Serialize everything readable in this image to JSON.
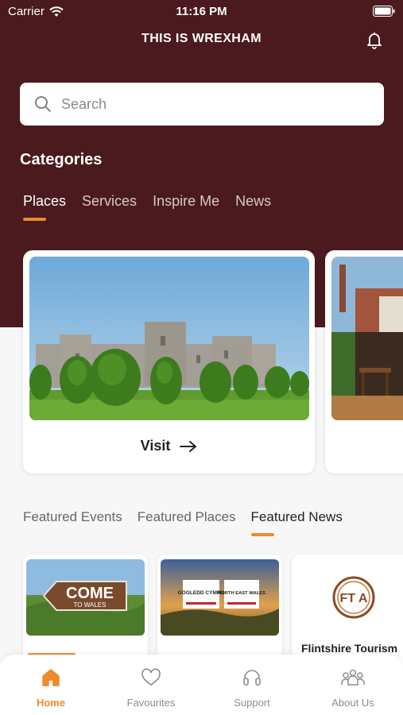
{
  "status_bar": {
    "carrier": "Carrier",
    "time": "11:16 PM"
  },
  "header": {
    "title": "THIS IS WREXHAM"
  },
  "search": {
    "placeholder": "Search"
  },
  "categories": {
    "heading": "Categories",
    "tabs": [
      "Places",
      "Services",
      "Inspire Me",
      "News"
    ],
    "active_tab": "Places"
  },
  "place_cards": [
    {
      "action_label": "Visit"
    }
  ],
  "featured": {
    "tabs": [
      "Featured Events",
      "Featured Places",
      "Featured News"
    ],
    "active_tab": "Featured News",
    "news": [
      {
        "image_text_main": "COME",
        "image_text_sub": "TO WALES"
      },
      {
        "image_text_left": "GOGLEDD CYMRU",
        "image_text_right": "NORTH EAST WALES"
      },
      {
        "logo_text": "FT A",
        "title": "Flintshire Tourism"
      }
    ]
  },
  "tabbar": {
    "items": [
      "Home",
      "Favourites",
      "Support",
      "About Us"
    ],
    "active": "Home"
  },
  "colors": {
    "brand": "#4a1a1e",
    "accent": "#f08a2b"
  },
  "icons": [
    "wifi-icon",
    "battery-icon",
    "bell-icon",
    "search-icon",
    "arrow-right-icon",
    "home-icon",
    "heart-icon",
    "headset-icon",
    "people-icon"
  ]
}
